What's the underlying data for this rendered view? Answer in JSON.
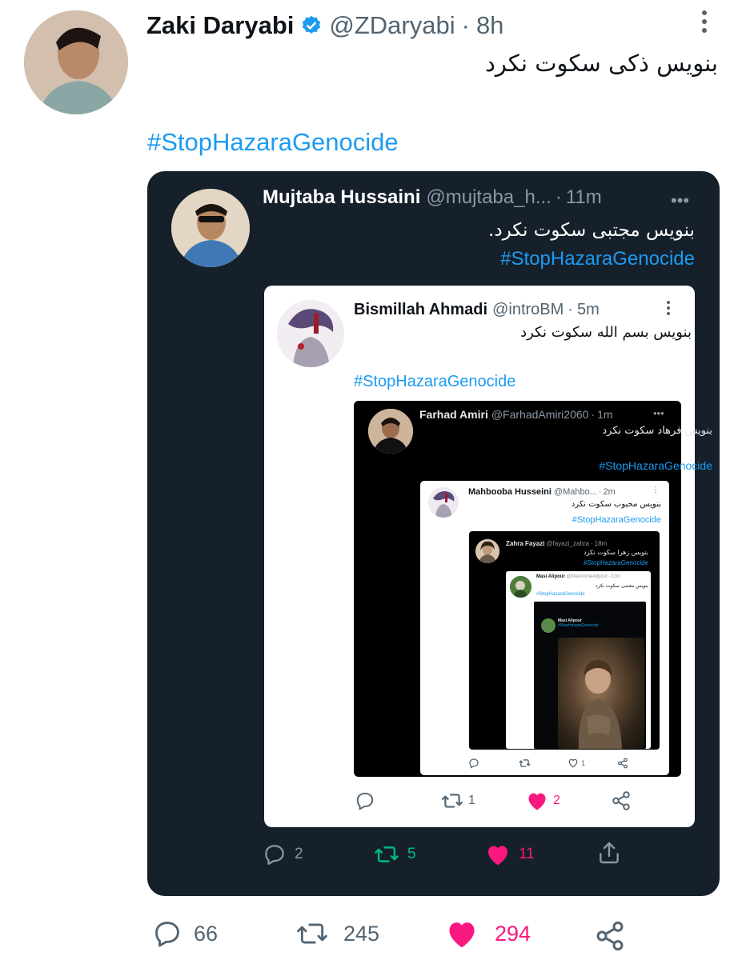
{
  "main_tweet": {
    "author_name": "Zaki Daryabi",
    "handle": "@ZDaryabi",
    "separator": "·",
    "time": "8h",
    "verified": true,
    "text": "بنویس ذکی سکوت نکرد",
    "hashtag": "#StopHazaraGenocide",
    "counts": {
      "replies": "66",
      "retweets": "245",
      "likes": "294"
    },
    "liked": true
  },
  "quote_1": {
    "author_name": "Mujtaba Hussaini",
    "handle": "@mujtaba_h...",
    "separator": "·",
    "time": "11m",
    "more": "•••",
    "text": "بنویس مجتبی سکوت نکرد.",
    "hashtag": "#StopHazaraGenocide",
    "counts": {
      "replies": "2",
      "retweets": "5",
      "likes": "11"
    }
  },
  "quote_2": {
    "author_name": "Bismillah Ahmadi",
    "handle": "@introBM",
    "separator": "·",
    "time": "5m",
    "text": "بنویس بسم الله سکوت نکرد",
    "hashtag": "#StopHazaraGenocide",
    "counts": {
      "retweets": "1",
      "likes": "2"
    }
  },
  "quote_3": {
    "author_name": "Farhad Amiri",
    "handle": "@FarhadAmiri2060",
    "separator": "·",
    "time": "1m",
    "more": "•••",
    "text": "بنویس فرهاد سکوت نکرد",
    "hashtag": "#StopHazaraGenocide"
  },
  "quote_4": {
    "author_name": "Mahbooba Husseini",
    "handle": "@Mahbo...",
    "separator": "·",
    "time": "2m",
    "more": "⋮",
    "text": "بنویس محبوب سکوت نکرد",
    "hashtag": "#StopHazaraGenocide",
    "counts": {
      "likes": "1"
    }
  },
  "quote_5": {
    "author_name": "Zahra Fayazi",
    "handle": "@fayazi_zahra",
    "separator": "·",
    "time": "18m",
    "text": "بنویس زهرا سکوت نکرد",
    "hashtag": "#StopHazaraGenocide"
  },
  "quote_6": {
    "author_name": "Masi Alipour",
    "handle": "@MasoomeAlipour",
    "separator": "·",
    "time": "22m",
    "text": "بنویس معصی سکوت نکرد",
    "hashtag": "#StopHazaraGenocide"
  },
  "quote_7": {
    "author_name": "Masi Alipour",
    "hashtag": "#StopHazaraGenocide"
  },
  "colors": {
    "hashtag": "#1d9bf0",
    "like": "#f91880",
    "retweet": "#00ba7c",
    "dark_card": "#15202b"
  }
}
